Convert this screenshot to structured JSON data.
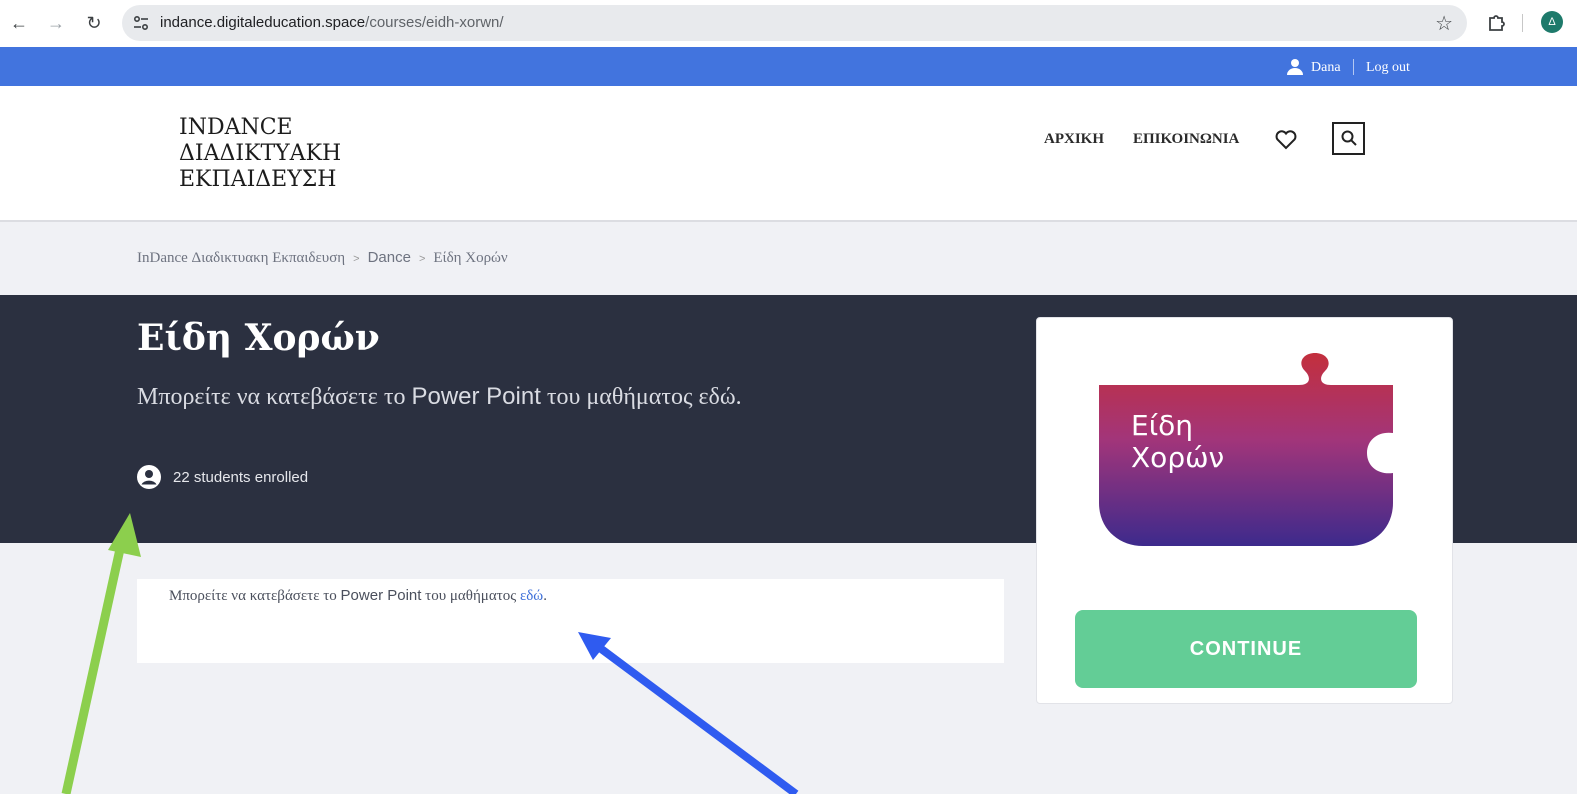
{
  "browser": {
    "url_domain": "indance.digitaleducation.space",
    "url_path": "/courses/eidh-xorwn/",
    "profile_initial": "Δ"
  },
  "topbar": {
    "username": "Dana",
    "logout_label": "Log out"
  },
  "header": {
    "logo_lines": [
      "INDANCE",
      "ΔΙΑΔΙΚΤΥΑΚΗ",
      "ΕΚΠΑΙΔΕΥΣΗ"
    ],
    "menu": [
      "ΑΡΧΙΚΗ",
      "ΕΠΙΚΟΙΝΩΝΙΑ"
    ]
  },
  "breadcrumb": {
    "items": [
      "InDance Διαδικτυακη Εκπαιδευση",
      "Dance",
      "Είδη Χορών"
    ]
  },
  "hero": {
    "title": "Είδη Χορών",
    "subtitle_before": "Μπορείτε να κατεβάσετε το ",
    "subtitle_product": "Power Point",
    "subtitle_after": " του μαθήματος εδώ.",
    "enrolled_text": "22 students enrolled"
  },
  "content": {
    "text_before": "Μπορείτε να κατεβάσετε το ",
    "text_product": "Power Point",
    "text_middle": " του μαθήματος ",
    "link_text": "εδώ",
    "text_end": "."
  },
  "card": {
    "thumbnail_line1": "Είδη",
    "thumbnail_line2": "Χορών",
    "continue_label": "CONTINUE"
  },
  "colors": {
    "topbar": "#4274de",
    "hero": "#2b3040",
    "continue": "#63cd96",
    "arrow_green": "#8ccf4d",
    "arrow_blue": "#2f5bf0"
  }
}
